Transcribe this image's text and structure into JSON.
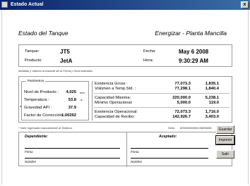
{
  "window": {
    "title": "Estado Actual",
    "close_glyph": "x"
  },
  "header": {
    "left": "Estado del Tanque",
    "right": "Energizar - Planta Mancilla"
  },
  "tank": {
    "tanque_label": "Tanque:",
    "tanque_value": "JT5",
    "producto_label": "Producto:",
    "producto_value": "JetA",
    "fecha_label": "Fecha:",
    "fecha_value": "May 6 2008",
    "hora_label": "Hora:",
    "hora_value": "9:30:29 AM"
  },
  "note_measures": "Medidas y Valores al instante de la Fecha y Hora indicados",
  "params": {
    "legend": "Parámetros",
    "rows": [
      {
        "label": "Nivel de Producto :",
        "value": "4,025",
        "unit": "mm"
      },
      {
        "label": "Temperatura :",
        "value": "53.8",
        "unit": "°F"
      },
      {
        "label": "Gravedad API :",
        "value": "37.9",
        "marker": "*"
      },
      {
        "label": "Factor de Corrección :",
        "value": "1.00292"
      }
    ]
  },
  "volumes": {
    "col_galones": "Galones",
    "col_barriles": "Barriles",
    "rows": [
      {
        "label": "Existencia Gross :",
        "gal": "77,073.3",
        "bbl": "1,835.1"
      },
      {
        "label": "Volúmen a Temp.Std. :",
        "gal": "77,298.1",
        "bbl": "1,840.4"
      },
      {
        "label": "Capacidad Máxima:",
        "gal": "220,000.0",
        "bbl": "5,238.1"
      },
      {
        "label": "Mínimo Operacional:",
        "gal": "5,000.0",
        "bbl": "119.0"
      },
      {
        "label": "Existencia Operacional:",
        "gal": "72,073.3",
        "bbl": "1,716.0"
      },
      {
        "label": "Capacidad de Recibo:",
        "gal": "142,926.7",
        "bbl": "3,403.0"
      }
    ]
  },
  "note_manual": "* Valor ingresado manualmente al Sistema.",
  "sello": {
    "label": "Sello:",
    "value": "80920080306133806008"
  },
  "signatures": {
    "left_title": "Dependiente:",
    "right_title": "Aceptado:",
    "firma": "Firma",
    "nombre": "Nombre"
  },
  "buttons": {
    "guardar": "Guardar",
    "imprimir": "Imprimir",
    "salir": "Salir"
  }
}
